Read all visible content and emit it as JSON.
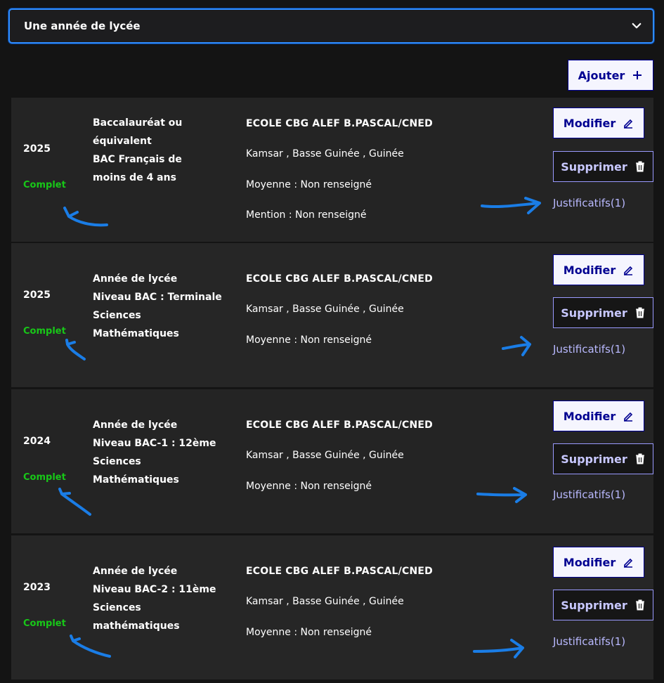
{
  "select": {
    "label": "Une année de lycée"
  },
  "add_button": {
    "label": "Ajouter"
  },
  "colors": {
    "accent_blue": "#000091",
    "status_green": "#18c718",
    "annotation_blue": "#1a7de6"
  },
  "icons": {
    "chevron": "chevron-down-icon",
    "plus": "plus-icon",
    "edit": "pencil-icon",
    "delete": "trash-icon"
  },
  "rows": [
    {
      "year": "2025",
      "status": "Complet",
      "diploma_lines": [
        "Baccalauréat ou",
        "équivalent",
        "BAC Français de",
        "moins de 4 ans"
      ],
      "school": "ECOLE CBG ALEF B.PASCAL/CNED",
      "location": "Kamsar , Basse Guinée , Guinée",
      "average": "Moyenne : Non renseigné",
      "mention": "Mention : Non renseigné",
      "edit_label": "Modifier",
      "delete_label": "Supprimer",
      "link_label": "Justificatifs(1)"
    },
    {
      "year": "2025",
      "status": "Complet",
      "diploma_lines": [
        "Année de lycée",
        "Niveau BAC : Terminale",
        "Sciences Mathématiques"
      ],
      "school": "ECOLE CBG ALEF B.PASCAL/CNED",
      "location": "Kamsar , Basse Guinée , Guinée",
      "average": "Moyenne : Non renseigné",
      "edit_label": "Modifier",
      "delete_label": "Supprimer",
      "link_label": "Justificatifs(1)"
    },
    {
      "year": "2024",
      "status": "Complet",
      "diploma_lines": [
        "Année de lycée",
        "Niveau BAC-1 : 12ème",
        "Sciences Mathématiques"
      ],
      "school": "ECOLE CBG ALEF B.PASCAL/CNED",
      "location": "Kamsar , Basse Guinée , Guinée",
      "average": "Moyenne : Non renseigné",
      "edit_label": "Modifier",
      "delete_label": "Supprimer",
      "link_label": "Justificatifs(1)"
    },
    {
      "year": "2023",
      "status": "Complet",
      "diploma_lines": [
        "Année de lycée",
        "Niveau BAC-2 : 11ème",
        "Sciences mathématiques"
      ],
      "school": "ECOLE CBG ALEF B.PASCAL/CNED",
      "location": "Kamsar , Basse Guinée , Guinée",
      "average": "Moyenne : Non renseigné",
      "edit_label": "Modifier",
      "delete_label": "Supprimer",
      "link_label": "Justificatifs(1)"
    }
  ]
}
